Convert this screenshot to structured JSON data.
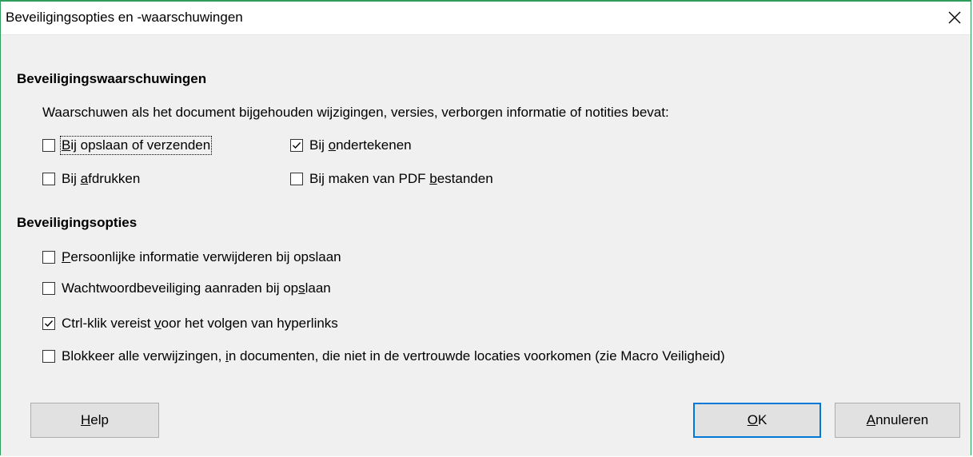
{
  "window": {
    "title": "Beveiligingsopties en -waarschuwingen"
  },
  "warnings": {
    "heading": "Beveiligingswaarschuwingen",
    "description": "Waarschuwen als het document bijgehouden wijzigingen, versies, verborgen informatie of notities bevat:",
    "items": [
      {
        "pre": "",
        "mn": "B",
        "post": "ij opslaan of verzenden",
        "checked": false
      },
      {
        "pre": "Bij ",
        "mn": "o",
        "post": "ndertekenen",
        "checked": true
      },
      {
        "pre": "Bij ",
        "mn": "a",
        "post": "fdrukken",
        "checked": false
      },
      {
        "pre": "Bij maken van PDF ",
        "mn": "b",
        "post": "estanden",
        "checked": false
      }
    ]
  },
  "options": {
    "heading": "Beveiligingsopties",
    "items": [
      {
        "pre": "",
        "mn": "P",
        "post": "ersoonlijke informatie verwijderen bij opslaan",
        "checked": false
      },
      {
        "pre": "Wachtwoordbeveiliging aanraden bij op",
        "mn": "s",
        "post": "laan",
        "checked": false
      },
      {
        "pre": "Ctrl-klik vereist ",
        "mn": "v",
        "post": "oor het volgen van hyperlinks",
        "checked": true
      },
      {
        "pre": "Blokkeer alle verwijzingen, ",
        "mn": "i",
        "post": "n documenten, die niet in de vertrouwde locaties voorkomen (zie Macro Veiligheid)",
        "checked": false
      }
    ]
  },
  "buttons": {
    "help": {
      "mn": "H",
      "post": "elp"
    },
    "ok": {
      "mn": "O",
      "post": "K"
    },
    "cancel": {
      "mn": "A",
      "post": "nnuleren"
    }
  },
  "colors": {
    "window_border": "#2e9c5a",
    "default_button_border": "#0078d7",
    "dialog_bg": "#f0f0f0"
  }
}
